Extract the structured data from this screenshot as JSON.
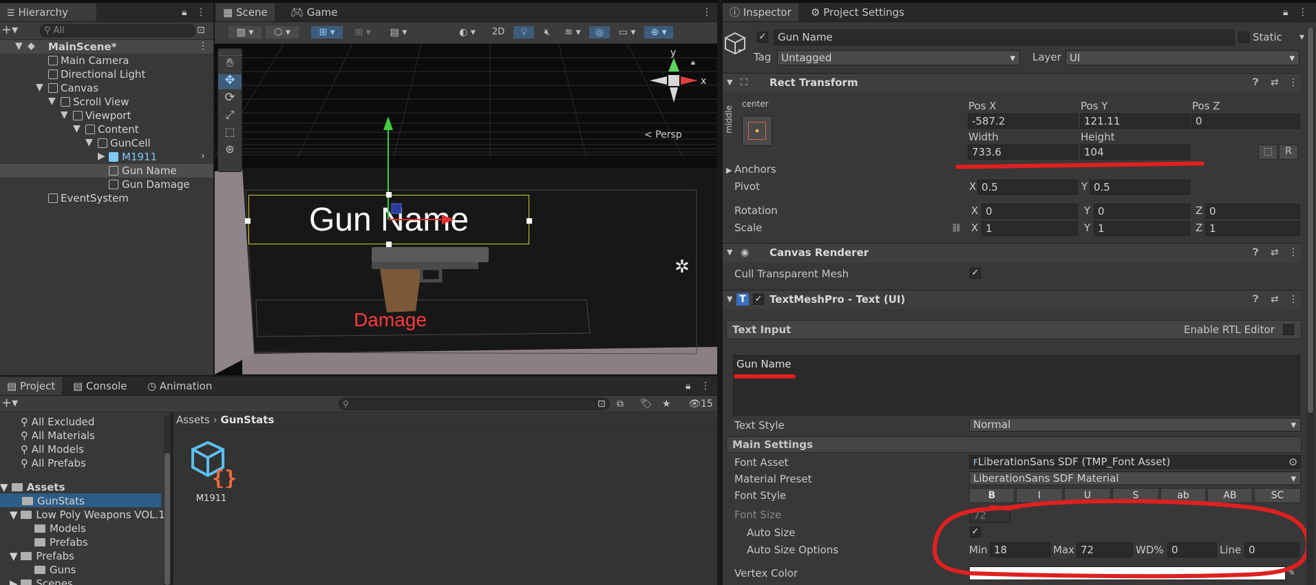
{
  "hierarchy": {
    "tab": "Hierarchy",
    "search_placeholder": "All",
    "items": [
      {
        "label": "MainScene*",
        "level": 0
      },
      {
        "label": "Main Camera",
        "level": 1
      },
      {
        "label": "Directional Light",
        "level": 1
      },
      {
        "label": "Canvas",
        "level": 1
      },
      {
        "label": "Scroll View",
        "level": 2
      },
      {
        "label": "Viewport",
        "level": 3
      },
      {
        "label": "Content",
        "level": 4
      },
      {
        "label": "GunCell",
        "level": 5
      },
      {
        "label": "M1911",
        "level": 6
      },
      {
        "label": "Gun Name",
        "level": 6
      },
      {
        "label": "Gun Damage",
        "level": 6
      },
      {
        "label": "EventSystem",
        "level": 1
      }
    ]
  },
  "scene": {
    "tabs": [
      "Scene",
      "Game"
    ],
    "toolbar_2d": "2D",
    "persp": "Persp",
    "axis_x": "x",
    "axis_y": "y",
    "gun_name_text": "Gun Name",
    "damage_text": "Damage"
  },
  "project": {
    "tabs": [
      "Project",
      "Console",
      "Animation"
    ],
    "hidden_count": "15",
    "favorites": [
      "All Excluded",
      "All Materials",
      "All Models",
      "All Prefabs"
    ],
    "tree": [
      {
        "label": "Assets",
        "level": 0
      },
      {
        "label": "GunStats",
        "level": 1
      },
      {
        "label": "Low Poly Weapons VOL.1",
        "level": 1
      },
      {
        "label": "Models",
        "level": 2
      },
      {
        "label": "Prefabs",
        "level": 2
      },
      {
        "label": "Prefabs",
        "level": 1
      },
      {
        "label": "Guns",
        "level": 2
      },
      {
        "label": "Scenes",
        "level": 1
      }
    ],
    "breadcrumb": [
      "Assets",
      "GunStats"
    ],
    "asset_name": "M1911"
  },
  "inspector": {
    "tabs": [
      "Inspector",
      "Project Settings"
    ],
    "object_name": "Gun Name",
    "static_label": "Static",
    "tag_label": "Tag",
    "tag_value": "Untagged",
    "layer_label": "Layer",
    "layer_value": "UI",
    "rect": {
      "title": "Rect Transform",
      "anchor_top": "center",
      "anchor_side": "middle",
      "posx_label": "Pos X",
      "posx": "-587.2",
      "posy_label": "Pos Y",
      "posy": "121.11",
      "posz_label": "Pos Z",
      "posz": "0",
      "width_label": "Width",
      "width": "733.6",
      "height_label": "Height",
      "height": "104",
      "anchors_label": "Anchors",
      "pivot_label": "Pivot",
      "pivot_x": "0.5",
      "pivot_y": "0.5",
      "rotation_label": "Rotation",
      "rot_x": "0",
      "rot_y": "0",
      "rot_z": "0",
      "scale_label": "Scale",
      "scale_x": "1",
      "scale_y": "1",
      "scale_z": "1",
      "x": "X",
      "y": "Y",
      "z": "Z",
      "r_button": "R"
    },
    "canvas_renderer": {
      "title": "Canvas Renderer",
      "cull_label": "Cull Transparent Mesh"
    },
    "tmp": {
      "title": "TextMeshPro - Text (UI)",
      "text_input_label": "Text Input",
      "rtl_label": "Enable RTL Editor",
      "text_value": "Gun Name",
      "text_style_label": "Text Style",
      "text_style_value": "Normal",
      "main_settings_label": "Main Settings",
      "font_asset_label": "Font Asset",
      "font_asset_value": "LiberationSans SDF (TMP_Font Asset)",
      "material_preset_label": "Material Preset",
      "material_preset_value": "LiberationSans SDF Material",
      "font_style_label": "Font Style",
      "font_style_buttons": [
        "B",
        "I",
        "U",
        "S",
        "ab",
        "AB",
        "SC"
      ],
      "font_size_label": "Font Size",
      "font_size_value": "72",
      "auto_size_label": "Auto Size",
      "auto_size_options_label": "Auto Size Options",
      "min_label": "Min",
      "min_value": "18",
      "max_label": "Max",
      "max_value": "72",
      "wd_label": "WD%",
      "wd_value": "0",
      "line_label": "Line",
      "line_value": "0",
      "vertex_color_label": "Vertex Color"
    }
  },
  "colors": {
    "selection": "#2c5d87",
    "annotation_red": "#e02020",
    "prefab_blue": "#7cc8f8",
    "damage_red": "#ff3b3b"
  }
}
